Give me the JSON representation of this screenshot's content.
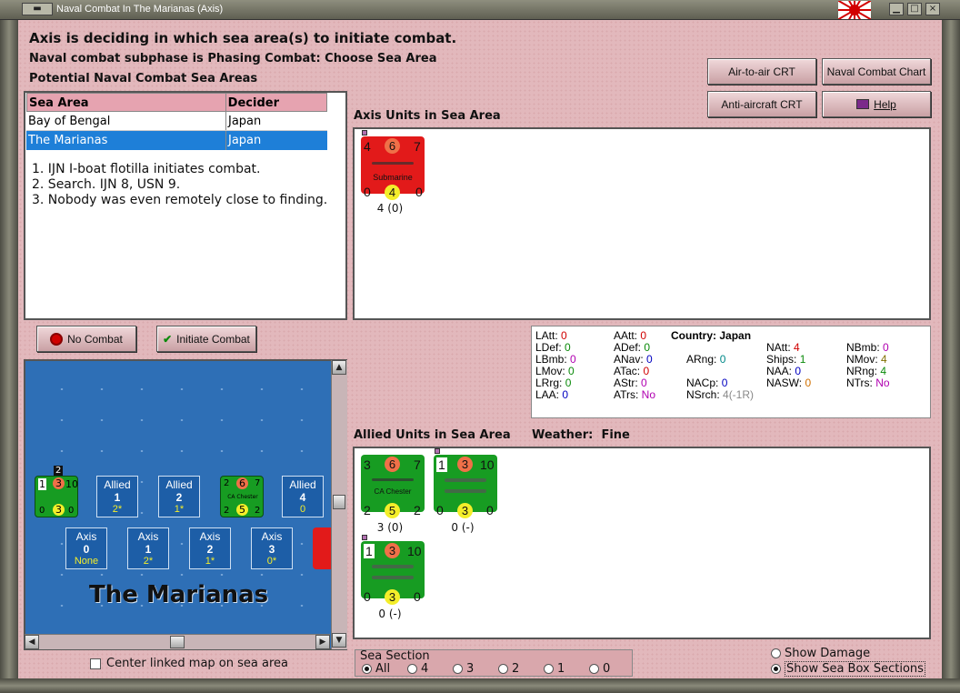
{
  "window": {
    "title": "Naval Combat In The Marianas (Axis)"
  },
  "header": {
    "line1": "Axis is deciding in which sea area(s) to initiate combat.",
    "line2": "Naval combat subphase is Phasing Combat: Choose Sea Area",
    "line3": "Potential Naval Combat Sea Areas"
  },
  "buttons": {
    "air_to_air": "Air-to-air CRT",
    "naval_combat_chart": "Naval Combat Chart",
    "anti_aircraft": "Anti-aircraft CRT",
    "help": "Help",
    "no_combat": "No Combat",
    "initiate_combat": "Initiate Combat"
  },
  "sea_table": {
    "headers": [
      "Sea Area",
      "Decider"
    ],
    "rows": [
      {
        "area": "Bay of Bengal",
        "decider": "Japan"
      },
      {
        "area": "The Marianas",
        "decider": "Japan"
      }
    ]
  },
  "log": [
    "1. IJN I-boat flotilla initiates combat.",
    "2. Search. IJN 8, USN 9.",
    "3. Nobody was even remotely close to finding."
  ],
  "axis_section": {
    "title": "Axis Units in Sea Area",
    "units": [
      {
        "tl": "4",
        "tc": "6",
        "tr": "7",
        "name": "Submarine",
        "bl": "0",
        "bc": "4",
        "br": "0",
        "strength": "4 (0)"
      }
    ]
  },
  "allied_section": {
    "title": "Allied Units in Sea Area",
    "weather_label": "Weather:",
    "weather_value": "Fine",
    "units": [
      {
        "tl": "3",
        "tc": "6",
        "tr": "7",
        "name": "CA Chester",
        "bl": "2",
        "bc": "5",
        "br": "2",
        "strength": "3 (0)"
      },
      {
        "tl": "1",
        "tc": "3",
        "tr": "10",
        "name": "",
        "bl": "0",
        "bc": "3",
        "br": "0",
        "strength": "0 (-)"
      },
      {
        "tl": "1",
        "tc": "3",
        "tr": "10",
        "name": "",
        "bl": "0",
        "bc": "3",
        "br": "0",
        "strength": "0 (-)"
      }
    ]
  },
  "stats": {
    "country_label": "Country:",
    "country": "Japan",
    "items": [
      {
        "k": "LAtt:",
        "v": "0",
        "c": "#d00000"
      },
      {
        "k": "LDef:",
        "v": "0",
        "c": "#0a8a0a"
      },
      {
        "k": "LBmb:",
        "v": "0",
        "c": "#b000b0"
      },
      {
        "k": "LMov:",
        "v": "0",
        "c": "#0a8a0a"
      },
      {
        "k": "LRrg:",
        "v": "0",
        "c": "#0a8a0a"
      },
      {
        "k": "LAA:",
        "v": "0",
        "c": "#0000c0"
      },
      {
        "k": "AAtt:",
        "v": "0",
        "c": "#d00000"
      },
      {
        "k": "ADef:",
        "v": "0",
        "c": "#0a8a0a"
      },
      {
        "k": "ANav:",
        "v": "0",
        "c": "#0000c0"
      },
      {
        "k": "ATac:",
        "v": "0",
        "c": "#d00000"
      },
      {
        "k": "AStr:",
        "v": "0",
        "c": "#b000b0"
      },
      {
        "k": "ATrs:",
        "v": "No",
        "c": "#b000b0"
      },
      {
        "k": "ARng:",
        "v": "0",
        "c": "#008888"
      },
      {
        "k": "NACp:",
        "v": "0",
        "c": "#0000c0"
      },
      {
        "k": "NSrch:",
        "v": "4(-1R)",
        "c": "#888888"
      },
      {
        "k": "NAtt:",
        "v": "4",
        "c": "#d00000"
      },
      {
        "k": "Ships:",
        "v": "1",
        "c": "#0a8a0a"
      },
      {
        "k": "NAA:",
        "v": "0",
        "c": "#0000c0"
      },
      {
        "k": "NASW:",
        "v": "0",
        "c": "#d07000"
      },
      {
        "k": "NBmb:",
        "v": "0",
        "c": "#b000b0"
      },
      {
        "k": "NMov:",
        "v": "4",
        "c": "#807000"
      },
      {
        "k": "NRng:",
        "v": "4",
        "c": "#0a8a0a"
      },
      {
        "k": "NTrs:",
        "v": "No",
        "c": "#b000b0"
      }
    ]
  },
  "map": {
    "title": "The Marianas",
    "allied_boxes": [
      {
        "side": "Allied",
        "num": "1",
        "val": "2*"
      },
      {
        "side": "Allied",
        "num": "2",
        "val": "1*"
      },
      {
        "side": "Allied",
        "num": "4",
        "val": "0"
      }
    ],
    "axis_boxes": [
      {
        "side": "Axis",
        "num": "0",
        "val": "None"
      },
      {
        "side": "Axis",
        "num": "1",
        "val": "2*"
      },
      {
        "side": "Axis",
        "num": "2",
        "val": "1*"
      },
      {
        "side": "Axis",
        "num": "3",
        "val": "0*"
      }
    ],
    "stack_count": "2",
    "mini_units": [
      {
        "tl": "1",
        "tc": "3",
        "tr": "10",
        "bl": "0",
        "bc": "3",
        "br": "0"
      },
      {
        "tl": "2",
        "tc": "6",
        "tr": "7",
        "bl": "2",
        "bc": "5",
        "br": "2",
        "name": "CA Chester"
      }
    ]
  },
  "center_map_label": "Center linked map on sea area",
  "sea_section": {
    "legend": "Sea Section",
    "options": [
      "All",
      "4",
      "3",
      "2",
      "1",
      "0"
    ],
    "selected": "All"
  },
  "options": {
    "show_damage": "Show Damage",
    "show_sections": "Show Sea Box Sections"
  }
}
